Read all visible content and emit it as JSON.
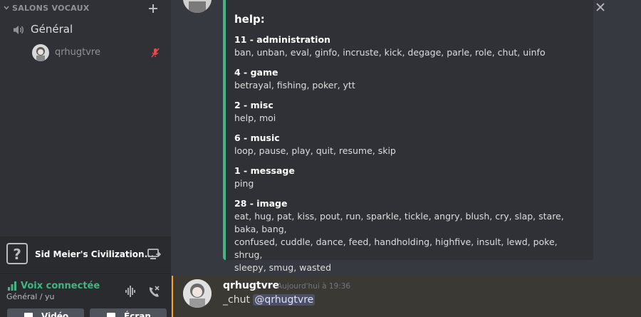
{
  "sidebar": {
    "category_title": "SALONS VOCAUX",
    "voice_channel": {
      "name": "Général"
    },
    "voice_user": {
      "name": "qrhugtvre"
    },
    "activity": {
      "icon_char": "?",
      "name": "Sid Meier's Civilization..."
    },
    "voice_panel": {
      "status": "Voix connectée",
      "sub": "Général / yu",
      "btn_video_label": "Vidéo",
      "btn_screen_label": "Écran"
    }
  },
  "embed": {
    "title": "help:",
    "fields": [
      {
        "name": "11 - administration",
        "value": "ban, unban, eval, ginfo, incruste, kick, degage, parle, role, chut, uinfo"
      },
      {
        "name": "4 - game",
        "value": "betrayal, fishing, poker, ytt"
      },
      {
        "name": "2 - misc",
        "value": "help, moi"
      },
      {
        "name": "6 - music",
        "value": "loop, pause, play, quit, resume, skip"
      },
      {
        "name": "1 - message",
        "value": "ping"
      },
      {
        "name": "28 - image",
        "value_lines": [
          "eat, hug, pat, kiss, pout, run, sparkle, tickle, angry, blush, cry, slap, stare, baka, bang,",
          "confused, cuddle, dance, feed, handholding, highfive, insult, lewd, poke, shrug,",
          "sleepy, smug, wasted"
        ]
      }
    ]
  },
  "message": {
    "author": "qrhugtvre",
    "timestamp": "Aujourd'hui à 19:36",
    "text": "_chut",
    "mention": "@qrhugtvre"
  },
  "colors": {
    "embed_border": "#43b581",
    "voice_status": "#43b581",
    "highlight_border": "#faa61a",
    "mute_icon": "#f04747"
  }
}
